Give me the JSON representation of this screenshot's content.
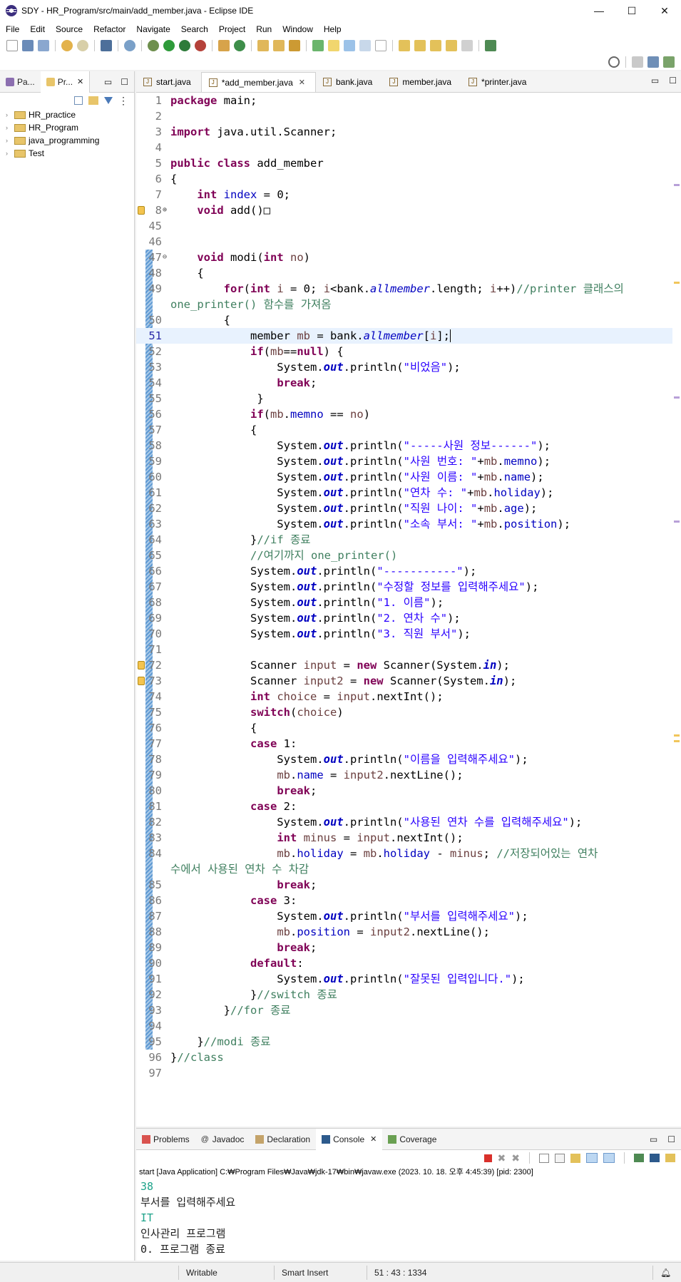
{
  "window": {
    "title": "SDY - HR_Program/src/main/add_member.java - Eclipse IDE",
    "buttons": [
      "—",
      "☐",
      "✕"
    ]
  },
  "menu": [
    "File",
    "Edit",
    "Source",
    "Refactor",
    "Navigate",
    "Search",
    "Project",
    "Run",
    "Window",
    "Help"
  ],
  "left_panel": {
    "tabs": [
      "Pa...",
      "Pr..."
    ],
    "tree": [
      "HR_practice",
      "HR_Program",
      "java_programming",
      "Test"
    ]
  },
  "editor": {
    "tabs": [
      {
        "label": "start.java",
        "active": false
      },
      {
        "label": "*add_member.java",
        "active": true
      },
      {
        "label": "bank.java",
        "active": false
      },
      {
        "label": "member.java",
        "active": false
      },
      {
        "label": "*printer.java",
        "active": false
      }
    ],
    "lines": [
      {
        "n": "1",
        "html": "<span class='kw'>package</span> main;"
      },
      {
        "n": "2",
        "html": ""
      },
      {
        "n": "3",
        "html": "<span class='kw'>import</span> java.util.Scanner;"
      },
      {
        "n": "4",
        "html": ""
      },
      {
        "n": "5",
        "html": "<span class='kw'>public</span> <span class='kw'>class</span> add_member"
      },
      {
        "n": "6",
        "html": "{"
      },
      {
        "n": "7",
        "html": "    <span class='kw'>int</span> <span class='fld'>index</span> = 0;"
      },
      {
        "n": "8",
        "html": "    <span class='kw'>void</span> add()□",
        "marker": true,
        "fold": "⊕"
      },
      {
        "n": "45",
        "html": ""
      },
      {
        "n": "46",
        "html": ""
      },
      {
        "n": "47",
        "html": "    <span class='kw'>void</span> modi(<span class='kw'>int</span> <span class='loc'>no</span>)",
        "fold": "⊖",
        "changed": true
      },
      {
        "n": "48",
        "html": "    {",
        "changed": true
      },
      {
        "n": "49",
        "html": "        <span class='kw'>for</span>(<span class='kw'>int</span> <span class='loc'>i</span> = 0; <span class='loc'>i</span>&lt;bank.<span class='sfld' style='font-weight:normal'>allmember</span>.length; <span class='loc'>i</span>++)<span class='cm'>//printer 클래스의</span>",
        "changed": true
      },
      {
        "n": "",
        "html": "<span class='cm'>one_printer() 함수를 가져옴</span>",
        "wrapcont": true
      },
      {
        "n": "50",
        "html": "        {",
        "changed": true
      },
      {
        "n": "51",
        "html": "            member <span class='loc'>mb</span> = bank.<span class='sfld' style='font-weight:normal'>allmember</span>[<span class='loc'>i</span>];|",
        "cursor": true,
        "changed": true
      },
      {
        "n": "52",
        "html": "            <span class='kw'>if</span>(<span class='loc'>mb</span>==<span class='kw'>null</span>) {",
        "changed": true
      },
      {
        "n": "53",
        "html": "                System.<span class='sfld'>out</span>.println(<span class='st'>\"비었음\"</span>);",
        "changed": true
      },
      {
        "n": "54",
        "html": "                <span class='kw'>break</span>;",
        "changed": true
      },
      {
        "n": "55",
        "html": "             }",
        "changed": true
      },
      {
        "n": "56",
        "html": "            <span class='kw'>if</span>(<span class='loc'>mb</span>.<span class='fld'>memno</span> == <span class='loc'>no</span>)",
        "changed": true
      },
      {
        "n": "57",
        "html": "            {",
        "changed": true
      },
      {
        "n": "58",
        "html": "                System.<span class='sfld'>out</span>.println(<span class='st'>\"-----사원 정보------\"</span>);",
        "changed": true
      },
      {
        "n": "59",
        "html": "                System.<span class='sfld'>out</span>.println(<span class='st'>\"사원 번호: \"</span>+<span class='loc'>mb</span>.<span class='fld'>memno</span>);",
        "changed": true
      },
      {
        "n": "60",
        "html": "                System.<span class='sfld'>out</span>.println(<span class='st'>\"사원 이름: \"</span>+<span class='loc'>mb</span>.<span class='fld'>name</span>);",
        "changed": true
      },
      {
        "n": "61",
        "html": "                System.<span class='sfld'>out</span>.println(<span class='st'>\"연차 수: \"</span>+<span class='loc'>mb</span>.<span class='fld'>holiday</span>);",
        "changed": true
      },
      {
        "n": "62",
        "html": "                System.<span class='sfld'>out</span>.println(<span class='st'>\"직원 나이: \"</span>+<span class='loc'>mb</span>.<span class='fld'>age</span>);",
        "changed": true
      },
      {
        "n": "63",
        "html": "                System.<span class='sfld'>out</span>.println(<span class='st'>\"소속 부서: \"</span>+<span class='loc'>mb</span>.<span class='fld'>position</span>);",
        "changed": true
      },
      {
        "n": "64",
        "html": "            }<span class='cm'>//if 종료</span>",
        "changed": true
      },
      {
        "n": "65",
        "html": "            <span class='cm'>//여기까지 one_printer()</span>",
        "changed": true
      },
      {
        "n": "66",
        "html": "            System.<span class='sfld'>out</span>.println(<span class='st'>\"-----------\"</span>);",
        "changed": true
      },
      {
        "n": "67",
        "html": "            System.<span class='sfld'>out</span>.println(<span class='st'>\"수정할 정보를 입력해주세요\"</span>);",
        "changed": true
      },
      {
        "n": "68",
        "html": "            System.<span class='sfld'>out</span>.println(<span class='st'>\"1. 이름\"</span>);",
        "changed": true
      },
      {
        "n": "69",
        "html": "            System.<span class='sfld'>out</span>.println(<span class='st'>\"2. 연차 수\"</span>);",
        "changed": true
      },
      {
        "n": "70",
        "html": "            System.<span class='sfld'>out</span>.println(<span class='st'>\"3. 직원 부서\"</span>);",
        "changed": true
      },
      {
        "n": "71",
        "html": "",
        "changed": true
      },
      {
        "n": "72",
        "html": "            Scanner <span class='loc'>input</span> = <span class='kw'>new</span> Scanner(System.<span class='sfld'>in</span>);",
        "marker": true,
        "changed": true
      },
      {
        "n": "73",
        "html": "            Scanner <span class='loc'>input2</span> = <span class='kw'>new</span> Scanner(System.<span class='sfld'>in</span>);",
        "marker": true,
        "changed": true
      },
      {
        "n": "74",
        "html": "            <span class='kw'>int</span> <span class='loc'>choice</span> = <span class='loc'>input</span>.nextInt();",
        "changed": true
      },
      {
        "n": "75",
        "html": "            <span class='kw'>switch</span>(<span class='loc'>choice</span>)",
        "changed": true
      },
      {
        "n": "76",
        "html": "            {",
        "changed": true
      },
      {
        "n": "77",
        "html": "            <span class='kw'>case</span> 1:",
        "changed": true
      },
      {
        "n": "78",
        "html": "                System.<span class='sfld'>out</span>.println(<span class='st'>\"이름을 입력해주세요\"</span>);",
        "changed": true
      },
      {
        "n": "79",
        "html": "                <span class='loc'>mb</span>.<span class='fld'>name</span> = <span class='loc'>input2</span>.nextLine();",
        "changed": true
      },
      {
        "n": "80",
        "html": "                <span class='kw'>break</span>;",
        "changed": true
      },
      {
        "n": "81",
        "html": "            <span class='kw'>case</span> 2:",
        "changed": true
      },
      {
        "n": "82",
        "html": "                System.<span class='sfld'>out</span>.println(<span class='st'>\"사용된 연차 수를 입력해주세요\"</span>);",
        "changed": true
      },
      {
        "n": "83",
        "html": "                <span class='kw'>int</span> <span class='loc'>minus</span> = <span class='loc'>input</span>.nextInt();",
        "changed": true
      },
      {
        "n": "84",
        "html": "                <span class='loc'>mb</span>.<span class='fld'>holiday</span> = <span class='loc'>mb</span>.<span class='fld'>holiday</span> - <span class='loc'>minus</span>; <span class='cm'>//저장되어있는 연차</span>",
        "changed": true
      },
      {
        "n": "",
        "html": "<span class='cm'>수에서 사용된 연차 수 차감</span>",
        "wrapcont": true
      },
      {
        "n": "85",
        "html": "                <span class='kw'>break</span>;",
        "changed": true
      },
      {
        "n": "86",
        "html": "            <span class='kw'>case</span> 3:",
        "changed": true
      },
      {
        "n": "87",
        "html": "                System.<span class='sfld'>out</span>.println(<span class='st'>\"부서를 입력해주세요\"</span>);",
        "changed": true
      },
      {
        "n": "88",
        "html": "                <span class='loc'>mb</span>.<span class='fld'>position</span> = <span class='loc'>input2</span>.nextLine();",
        "changed": true
      },
      {
        "n": "89",
        "html": "                <span class='kw'>break</span>;",
        "changed": true
      },
      {
        "n": "90",
        "html": "            <span class='kw'>default</span>:",
        "changed": true
      },
      {
        "n": "91",
        "html": "                System.<span class='sfld'>out</span>.println(<span class='st'>\"잘못된 입력입니다.\"</span>);",
        "changed": true
      },
      {
        "n": "92",
        "html": "            }<span class='cm'>//switch 종료</span>",
        "changed": true
      },
      {
        "n": "93",
        "html": "        }<span class='cm'>//for 종료</span>",
        "changed": true
      },
      {
        "n": "94",
        "html": "",
        "changed": true
      },
      {
        "n": "95",
        "html": "    }<span class='cm'>//modi 종료</span>",
        "changed": true
      },
      {
        "n": "96",
        "html": "}<span class='cm'>//class</span>"
      },
      {
        "n": "97",
        "html": ""
      }
    ]
  },
  "console": {
    "tabs": [
      "Problems",
      "Javadoc",
      "Declaration",
      "Console",
      "Coverage"
    ],
    "active_tab": "Console",
    "path": "start [Java Application] C:₩Program Files₩Java₩jdk-17₩bin₩javaw.exe  (2023. 10. 18. 오후 4:45:39) [pid: 2300]",
    "output": [
      {
        "text": "38",
        "input": true
      },
      {
        "text": "부서를 입력해주세요",
        "input": false
      },
      {
        "text": "IT",
        "input": true
      },
      {
        "text": "인사관리 프로그램",
        "input": false
      },
      {
        "text": "0. 프로그램 종료",
        "input": false
      }
    ]
  },
  "status": {
    "mode": "Writable",
    "insert": "Smart Insert",
    "position": "51 : 43 : 1334"
  }
}
